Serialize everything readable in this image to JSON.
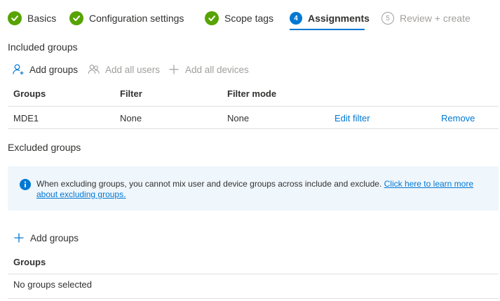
{
  "steps": [
    {
      "label": "Basics",
      "state": "done"
    },
    {
      "label": "Configuration settings",
      "state": "done"
    },
    {
      "label": "Scope tags",
      "state": "done"
    },
    {
      "label": "Assignments",
      "state": "current",
      "number": "4"
    },
    {
      "label": "Review + create",
      "state": "todo",
      "number": "5"
    }
  ],
  "included": {
    "heading": "Included groups",
    "commands": {
      "add_groups": "Add groups",
      "add_all_users": "Add all users",
      "add_all_devices": "Add all devices"
    },
    "columns": {
      "groups": "Groups",
      "filter": "Filter",
      "filter_mode": "Filter mode"
    },
    "rows": [
      {
        "group": "MDE1",
        "filter": "None",
        "filter_mode": "None",
        "edit_filter": "Edit filter",
        "remove": "Remove"
      }
    ]
  },
  "excluded": {
    "heading": "Excluded groups",
    "info_text": "When excluding groups, you cannot mix user and device groups across include and exclude. ",
    "info_link": "Click here to learn more about excluding groups.",
    "add_groups": "Add groups",
    "column_groups": "Groups",
    "empty_text": "No groups selected"
  },
  "colors": {
    "accent": "#0078d4",
    "success": "#57a300",
    "disabled": "#a19f9d",
    "info_bg": "#eff6fc"
  }
}
